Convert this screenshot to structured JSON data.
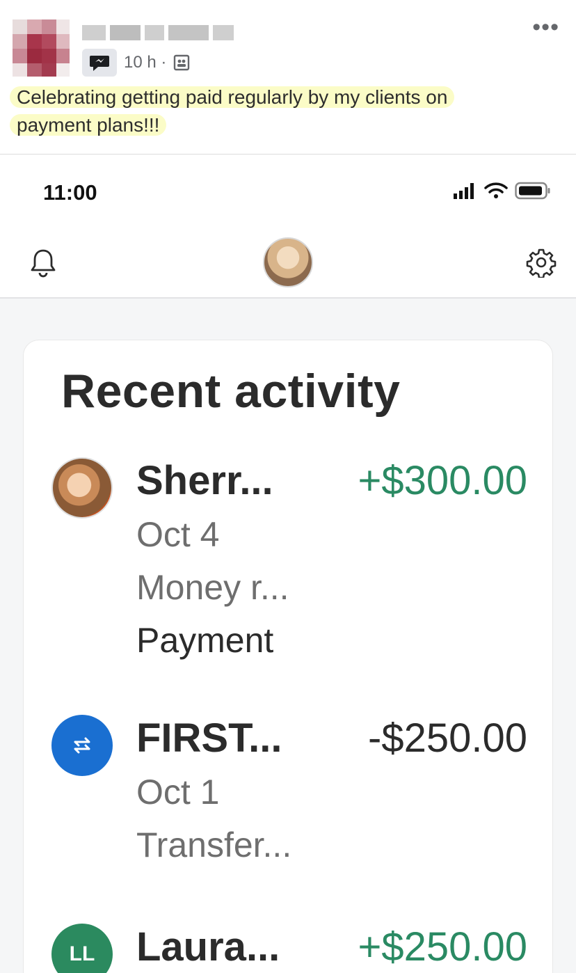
{
  "post": {
    "time": "10 h ·",
    "text_line1": "Celebrating getting paid regularly by my clients on",
    "text_line2": "payment plans!!!",
    "more_label": "•••"
  },
  "status_bar": {
    "time": "11:00"
  },
  "colors": {
    "highlight": "#fbfcc7",
    "positive": "#2a8a63",
    "transfer_blue": "#1a6fd1",
    "initials_green": "#2b8a5f"
  },
  "recent_activity": {
    "title": "Recent activity",
    "items": [
      {
        "name": "Sherr...",
        "amount": "+$300.00",
        "direction": "incoming",
        "date": "Oct 4",
        "note": "Money r...",
        "type": "Payment",
        "avatar": "photo"
      },
      {
        "name": "FIRST...",
        "amount": "-$250.00",
        "direction": "outgoing",
        "date": "Oct 1",
        "note": "Transfer...",
        "avatar": "transfer-icon"
      },
      {
        "name": "Laura...",
        "amount": "+$250.00",
        "direction": "incoming",
        "initials": "LL",
        "avatar": "initials"
      }
    ]
  }
}
